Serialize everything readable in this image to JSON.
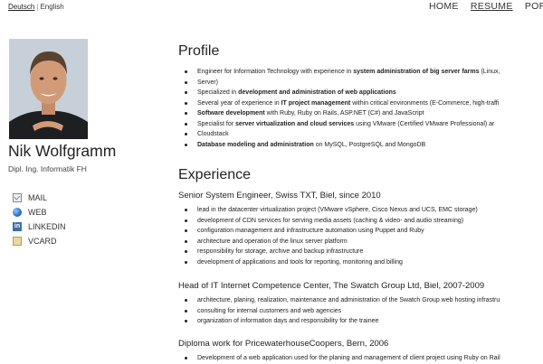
{
  "lang": {
    "active": "Deutsch",
    "separator": "|",
    "other": "English"
  },
  "nav": {
    "home": "HOME",
    "resume": "RESUME",
    "portfolio": "PORTF"
  },
  "sidebar": {
    "name": "Nik Wolfgramm",
    "subtitle": "Dipl. Ing. Informatik FH",
    "links": [
      {
        "label": "MAIL",
        "icon": "mail-icon"
      },
      {
        "label": "WEB",
        "icon": "globe-icon"
      },
      {
        "label": "LINKEDIN",
        "icon": "linkedin-icon"
      },
      {
        "label": "VCARD",
        "icon": "vcard-icon"
      }
    ]
  },
  "profile": {
    "heading": "Profile",
    "items": [
      {
        "pre": "Engineer for Information Technology with experience in ",
        "bold": "system administration of big server farms",
        "post": " (Linux,"
      },
      {
        "pre": "Server)",
        "bold": "",
        "post": ""
      },
      {
        "pre": "Specialized in ",
        "bold": "development and administration of web applications",
        "post": ""
      },
      {
        "pre": "Several year of experience in ",
        "bold": "IT project management",
        "post": " within critical environments (E-Commerce, high-traffi"
      },
      {
        "pre": "",
        "bold": "Software development",
        "post": " with Ruby, Ruby on Rails, ASP.NET (C#) and JavaScript"
      },
      {
        "pre": "Specialist for ",
        "bold": "server virtualization and cloud services",
        "post": " using VMware (Certified VMware Professional) ar"
      },
      {
        "pre": "Cloudstack",
        "bold": "",
        "post": ""
      },
      {
        "pre": "",
        "bold": "Database modeling and administration",
        "post": " on MySQL, PostgreSQL and MongoDB"
      }
    ]
  },
  "experience": {
    "heading": "Experience",
    "jobs": [
      {
        "title": "Senior System Engineer, Swiss TXT, Biel, since 2010",
        "items": [
          "lead in the datacenter virtualization project (VMware vSphere, Cisco Nexus and UCS, EMC storage)",
          "development of CDN services for serving media assets (caching & video- and audio streaming)",
          "configuration management and infrastructure automation using Puppet and Ruby",
          "architecture and operation of the linux server platform",
          "responsibility for storage, archive and backup infrastructure",
          "development of applications and tools for reporting, monitoring and billing"
        ]
      },
      {
        "title": "Head of IT Internet Competence Center, The Swatch Group Ltd, Biel, 2007-2009",
        "items": [
          "architecture, planing, realization, maintenance and administration of the Swatch Group web hosting infrastru",
          "consulting for internal customers and web agencies",
          "organization of information days and responsibility for the trainee"
        ]
      },
      {
        "title": "Diploma work for PricewaterhouseCoopers, Bern, 2006",
        "items": [
          "Development of a web application used for the planing and management of client project using Ruby on Rail"
        ]
      }
    ]
  }
}
